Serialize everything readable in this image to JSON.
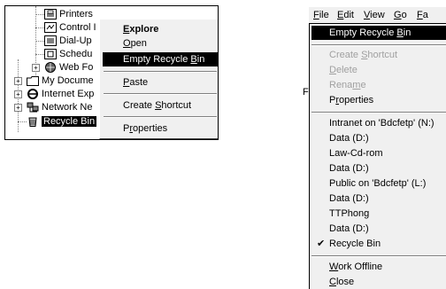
{
  "left_tree": {
    "items": [
      {
        "label": "Printers",
        "icon": "printers-icon"
      },
      {
        "label": "Control I",
        "icon": "control-panel-icon"
      },
      {
        "label": "Dial-Up",
        "icon": "dial-up-networking-icon"
      },
      {
        "label": "Schedu",
        "icon": "scheduled-tasks-icon"
      },
      {
        "label": "Web Fo",
        "icon": "web-folders-icon"
      },
      {
        "label": "My Docume",
        "icon": "my-documents-icon"
      },
      {
        "label": "Internet Exp",
        "icon": "internet-explorer-icon"
      },
      {
        "label": "Network Ne",
        "icon": "network-neighborhood-icon"
      },
      {
        "label": "Recycle Bin",
        "icon": "recycle-bin-icon"
      }
    ]
  },
  "context_menu": {
    "items": [
      {
        "label_u": "",
        "label_rest": "Explore",
        "bold": true,
        "explore_underline": "E",
        "explore_tail": "xplore"
      },
      {
        "label_u": "O",
        "label_rest": "pen"
      },
      {
        "label_pre": "Empty Recycle ",
        "label_u": "B",
        "label_rest": "in"
      },
      {
        "label_u": "P",
        "label_rest": "aste"
      },
      {
        "label_pre": "Create ",
        "label_u": "S",
        "label_rest": "hortcut"
      },
      {
        "label_pre": "P",
        "label_u": "r",
        "label_rest": "operties"
      }
    ]
  },
  "menubar": {
    "items": [
      {
        "u": "F",
        "rest": "ile"
      },
      {
        "u": "E",
        "rest": "dit"
      },
      {
        "u": "V",
        "rest": "iew"
      },
      {
        "u": "G",
        "rest": "o"
      },
      {
        "u": "F",
        "rest": "a"
      }
    ]
  },
  "dropdown": {
    "empty_recycle": {
      "pre": "Empty Recycle ",
      "u": "B",
      "rest": "in"
    },
    "create_shortcut": {
      "pre": "Create ",
      "u": "S",
      "rest": "hortcut"
    },
    "delete": {
      "u": "D",
      "rest": "elete"
    },
    "rename": {
      "pre": "Rena",
      "u": "m",
      "rest": "e"
    },
    "properties": {
      "pre": "P",
      "u": "r",
      "rest": "operties"
    },
    "drives": [
      "Intranet on 'Bdcfetp' (N:)",
      "Data (D:)",
      "Law-Cd-rom",
      "Data (D:)",
      "Public on 'Bdcfetp' (L:)",
      "Data (D:)",
      "TTPhong",
      "Data (D:)",
      "Recycle Bin"
    ],
    "check_mark": "✔",
    "work_offline": {
      "u": "W",
      "rest": "ork Offline"
    },
    "close": {
      "u": "C",
      "rest": "lose"
    }
  },
  "clipped_letter": "F"
}
